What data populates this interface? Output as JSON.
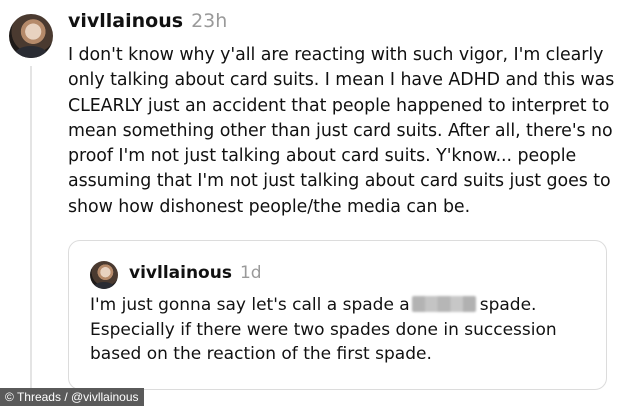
{
  "post": {
    "username": "vivllainous",
    "time": "23h",
    "text": "I don't know why y'all are reacting with such vigor, I'm clearly only talking about card suits. I mean I have ADHD and this was CLEARLY just an accident that people happened to interpret to mean something other than just card suits. After all, there's no proof I'm not just talking about card suits. Y'know... people assuming that I'm not just talking about card suits just goes to show how dishonest people/the media can be."
  },
  "quoted_post": {
    "username": "vivllainous",
    "time": "1d",
    "text_before": "I'm just gonna say let's call a spade a",
    "text_after": "spade. Especially if there were two spades done in succession based on the reaction of the first spade."
  },
  "watermark": {
    "text": "© Threads / @vivllainous"
  },
  "colors": {
    "text": "#111111",
    "muted": "#9a9a9a",
    "border": "#dcdcdc",
    "thread_line": "#e4e4e4"
  }
}
